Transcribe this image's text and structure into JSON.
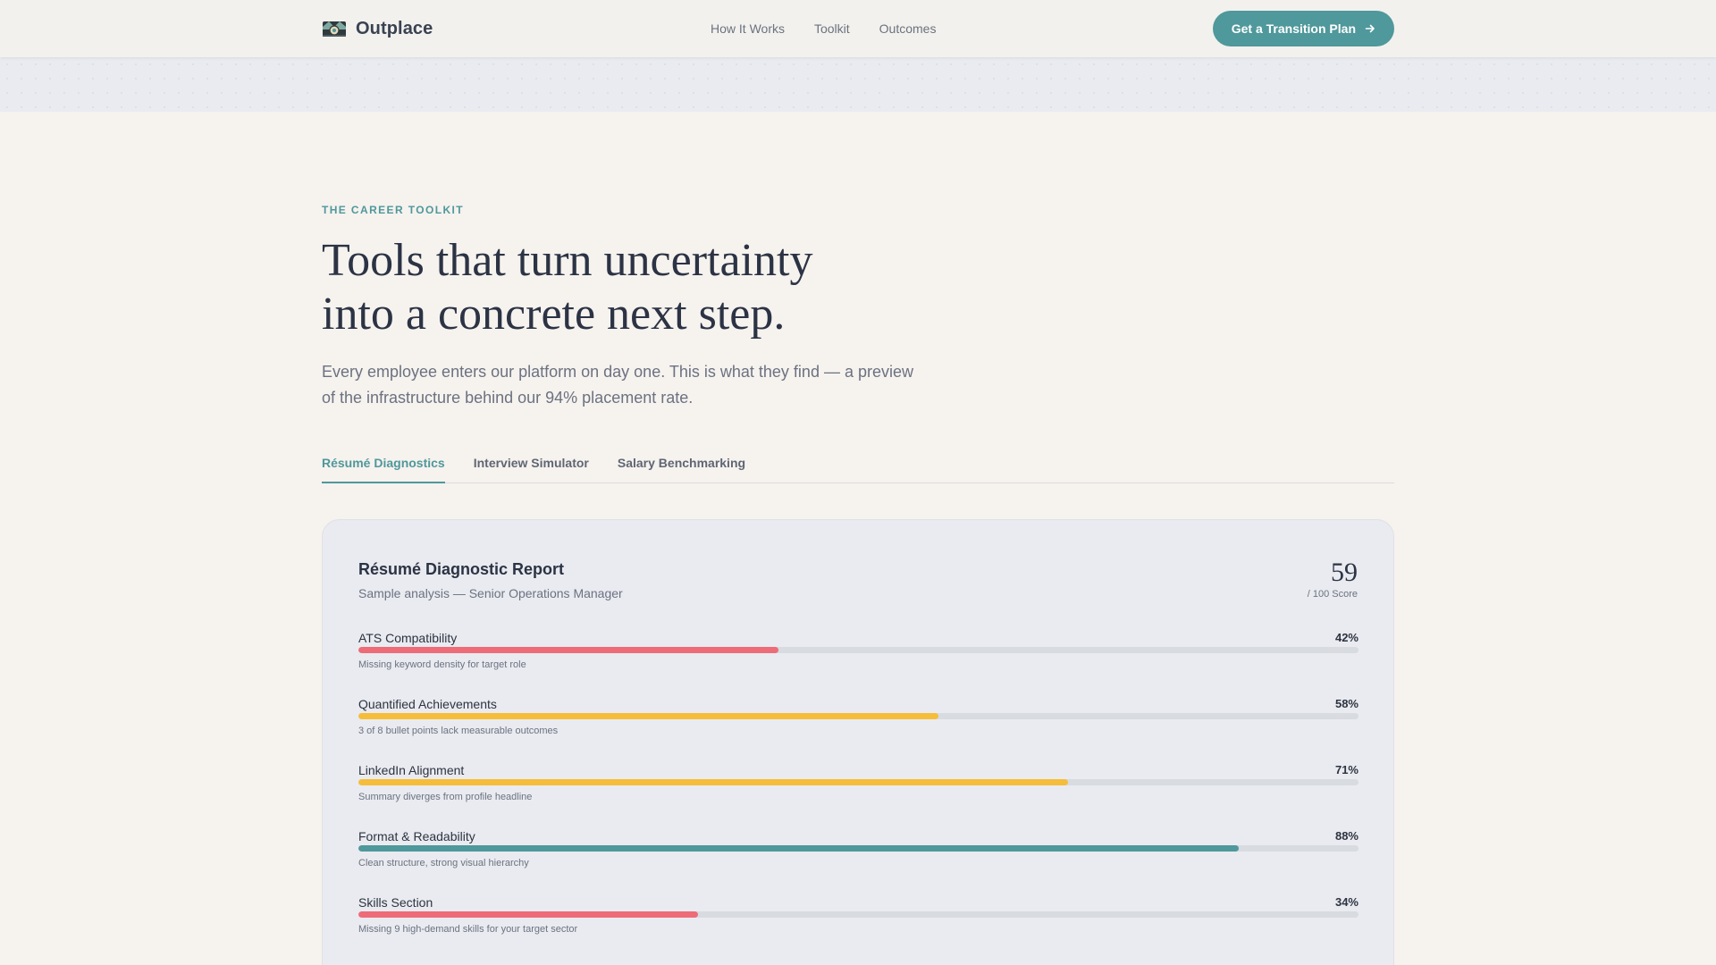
{
  "header": {
    "brand": "Outplace",
    "nav": [
      "How It Works",
      "Toolkit",
      "Outcomes"
    ],
    "cta_label": "Get a Transition Plan",
    "cta_icon": "arrow-right-icon"
  },
  "hero": {
    "eyebrow": "THE CAREER TOOLKIT",
    "headline_lines": [
      "Tools that turn uncertainty",
      "into a concrete next step."
    ],
    "lede_lines": [
      "Every employee enters our platform on day one. This is what they find — a preview",
      "of the infrastructure behind our 94% placement rate."
    ]
  },
  "tabs": {
    "items": [
      "Résumé Diagnostics",
      "Interview Simulator",
      "Salary Benchmarking"
    ],
    "active_index": 0
  },
  "report": {
    "title": "Résumé Diagnostic Report",
    "subtitle": "Sample analysis — Senior Operations Manager",
    "score": "59",
    "score_caption": "/ 100 Score",
    "metrics": [
      {
        "label": "ATS Compatibility",
        "percent_text": "42%",
        "value": 42,
        "note": "Missing keyword density for target role",
        "color": "#ee6b78"
      },
      {
        "label": "Quantified Achievements",
        "percent_text": "58%",
        "value": 58,
        "note": "3 of 8 bullet points lack measurable outcomes",
        "color": "#f5bd3a"
      },
      {
        "label": "LinkedIn Alignment",
        "percent_text": "71%",
        "value": 71,
        "note": "Summary diverges from profile headline",
        "color": "#f5bd3a"
      },
      {
        "label": "Format & Readability",
        "percent_text": "88%",
        "value": 88,
        "note": "Clean structure, strong visual hierarchy",
        "color": "#4f989b"
      },
      {
        "label": "Skills Section",
        "percent_text": "34%",
        "value": 34,
        "note": "Missing 9 high-demand skills for your target sector",
        "color": "#ee6b78"
      }
    ]
  },
  "colors": {
    "accent": "#4f989b",
    "background": "#f6f2ee",
    "card": "#e9ebf0",
    "danger": "#ee6b78",
    "warning": "#f5bd3a"
  }
}
